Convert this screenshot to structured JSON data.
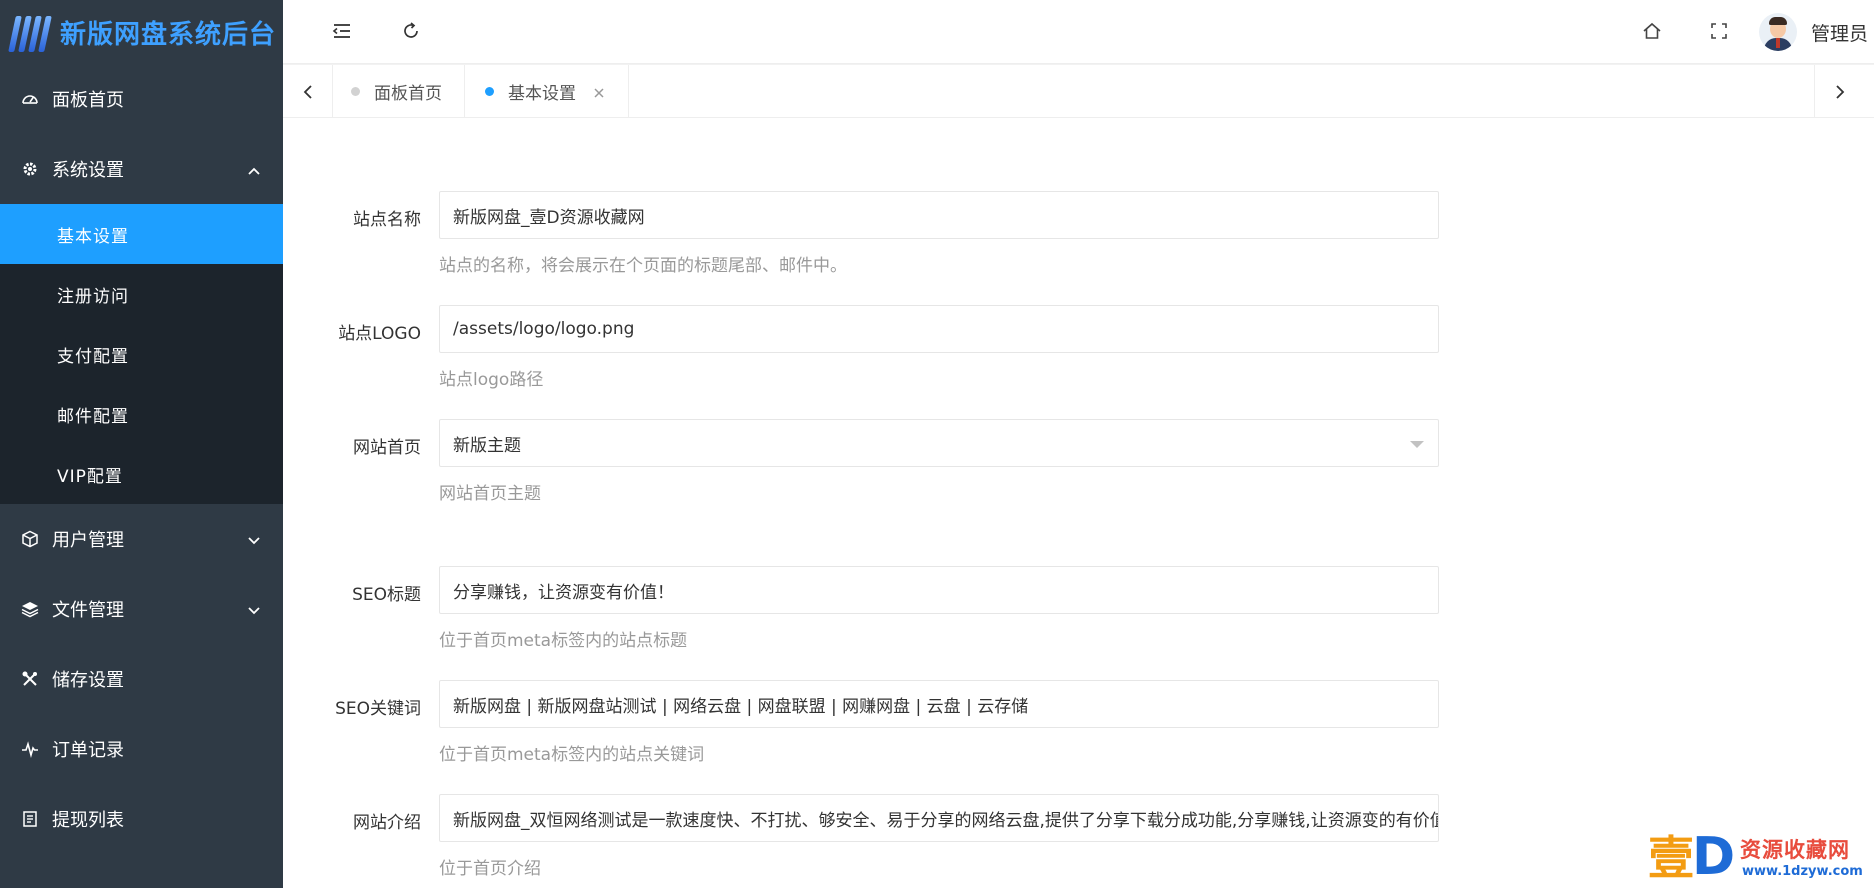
{
  "app": {
    "title": "新版网盘系统后台"
  },
  "sidebar": {
    "items": [
      {
        "label": "面板首页",
        "icon": "dashboard-icon"
      },
      {
        "label": "系统设置",
        "icon": "gear-icon",
        "expanded": true,
        "children": [
          {
            "label": "基本设置",
            "active": true
          },
          {
            "label": "注册访问"
          },
          {
            "label": "支付配置"
          },
          {
            "label": "邮件配置"
          },
          {
            "label": "VIP配置"
          }
        ]
      },
      {
        "label": "用户管理",
        "icon": "cube-icon"
      },
      {
        "label": "文件管理",
        "icon": "layers-icon"
      },
      {
        "label": "储存设置",
        "icon": "tools-icon"
      },
      {
        "label": "订单记录",
        "icon": "pulse-icon"
      },
      {
        "label": "提现列表",
        "icon": "list-icon"
      }
    ]
  },
  "header": {
    "user_name": "管理员"
  },
  "tabs": [
    {
      "label": "面板首页",
      "active": false
    },
    {
      "label": "基本设置",
      "active": true
    }
  ],
  "form": {
    "site_name": {
      "label": "站点名称",
      "value": "新版网盘_壹D资源收藏网",
      "hint": "站点的名称，将会展示在个页面的标题尾部、邮件中。"
    },
    "site_logo": {
      "label": "站点LOGO",
      "value": "/assets/logo/logo.png",
      "hint": "站点logo路径"
    },
    "home_theme": {
      "label": "网站首页",
      "value": "新版主题",
      "hint": "网站首页主题"
    },
    "seo_title": {
      "label": "SEO标题",
      "value": "分享赚钱，让资源变有价值！",
      "hint": "位于首页meta标签内的站点标题"
    },
    "seo_keywords": {
      "label": "SEO关键词",
      "value": "新版网盘 | 新版网盘站测试 | 网络云盘 | 网盘联盟 | 网赚网盘 | 云盘 | 云存储",
      "hint": "位于首页meta标签内的站点关键词"
    },
    "site_intro": {
      "label": "网站介绍",
      "value": "新版网盘_双恒网络测试是一款速度快、不打扰、够安全、易于分享的网络云盘,提供了分享下载分成功能,分享赚钱,让资源变的有价值",
      "hint": "位于首页介绍"
    }
  },
  "watermark": {
    "brand_char": "壹",
    "letter": "D",
    "text": "资源收藏网",
    "url": "www.1dzyw.com"
  },
  "colors": {
    "sidebar_bg": "#2f3a45",
    "submenu_bg": "#1c242c",
    "accent": "#1e9fff"
  }
}
